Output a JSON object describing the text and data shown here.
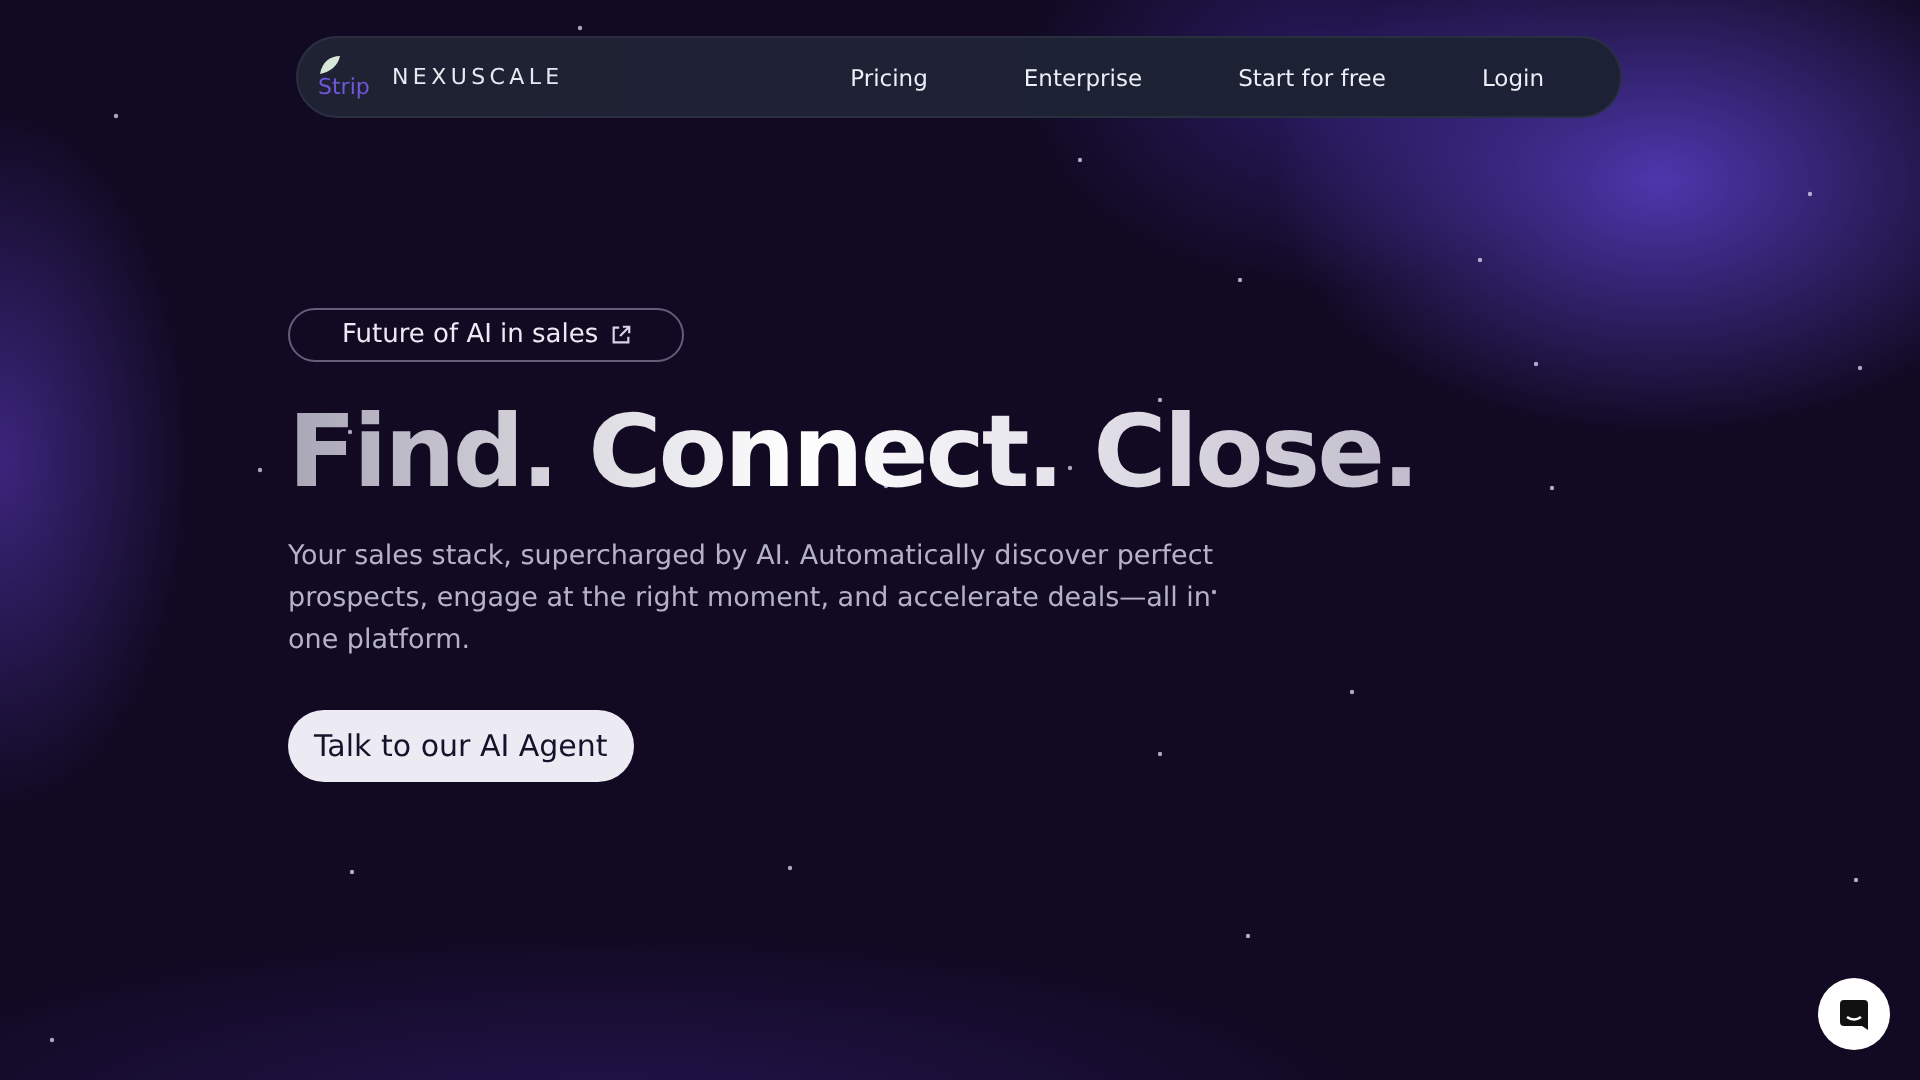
{
  "nav": {
    "logo_alt": "Strip",
    "brand": "NEXUSCALE",
    "links": [
      "Pricing",
      "Enterprise",
      "Start for free",
      "Login"
    ]
  },
  "hero": {
    "badge": "Future of AI in sales",
    "headline": "Find. Connect. Close.",
    "subtitle": "Your sales stack, supercharged by AI. Automatically discover perfect prospects, engage at the right moment, and accelerate deals—all in one platform.",
    "cta": "Talk to our AI Agent"
  }
}
